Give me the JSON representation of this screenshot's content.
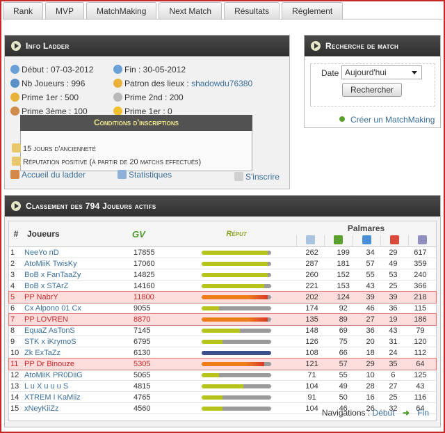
{
  "tabs": [
    "Rank",
    "MVP",
    "MatchMaking",
    "Next Match",
    "Résultats",
    "Réglement"
  ],
  "info": {
    "title": "Info Ladder",
    "debut": "Début : 07-03-2012",
    "fin": "Fin : 30-05-2012",
    "nb": "Nb Joueurs : 996",
    "patron_label": "Patron des lieux :",
    "patron": "shadowdu76380",
    "prime1": "Prime 1er : 500",
    "prime2": "Prime 2nd : 200",
    "prime3": "Prime 3ème : 100",
    "prime1b": "Prime 1er : 0",
    "cond_title": "Conditions d'inscriptions",
    "cond1": "15 jours d'ancienneté",
    "cond2": "Réputation positive (à partir de 20 matchs effectués)",
    "accueil": "Accueil du ladder",
    "stats": "Statistiques",
    "inscrire": "S'inscrire"
  },
  "search": {
    "title": "Recherche de match",
    "date_label": "Date",
    "date_value": "Aujourd'hui",
    "button": "Rechercher",
    "create": "Créer un MatchMaking"
  },
  "ranking": {
    "title": "Classement des 794 Joueurs actifs",
    "col_num": "#",
    "col_player": "Joueurs",
    "col_gv": "GV",
    "col_rep": "Réput",
    "palmares": "Palmares",
    "rows": [
      {
        "n": "1",
        "name": "NeeYo nD",
        "gv": "17855",
        "rep": 0.95,
        "c": [
          "262",
          "199",
          "34",
          "29",
          "617"
        ],
        "hl": false
      },
      {
        "n": "2",
        "name": "AtoMiiK TwisKy",
        "gv": "17060",
        "rep": 0.95,
        "c": [
          "287",
          "181",
          "57",
          "49",
          "359"
        ],
        "hl": false
      },
      {
        "n": "3",
        "name": "BoB x FanTaaZy",
        "gv": "14825",
        "rep": 0.95,
        "c": [
          "260",
          "152",
          "55",
          "53",
          "240"
        ],
        "hl": false
      },
      {
        "n": "4",
        "name": "BoB x STArZ",
        "gv": "14160",
        "rep": 0.9,
        "c": [
          "221",
          "153",
          "43",
          "25",
          "366"
        ],
        "hl": false
      },
      {
        "n": "5",
        "name": "PP NabrY",
        "gv": "11800",
        "rep": 0.95,
        "c": [
          "202",
          "124",
          "39",
          "39",
          "218"
        ],
        "hl": true
      },
      {
        "n": "6",
        "name": "Cx Alpono 01 Cx",
        "gv": "9055",
        "rep": 0.25,
        "c": [
          "174",
          "92",
          "46",
          "36",
          "115"
        ],
        "hl": false
      },
      {
        "n": "7",
        "name": "PP LOVREN",
        "gv": "8870",
        "rep": 0.95,
        "c": [
          "135",
          "89",
          "27",
          "19",
          "186"
        ],
        "hl": true
      },
      {
        "n": "8",
        "name": "EquaZ AsTonS",
        "gv": "7145",
        "rep": 0.55,
        "c": [
          "148",
          "69",
          "36",
          "43",
          "79"
        ],
        "hl": false
      },
      {
        "n": "9",
        "name": "STK x iKrymoS",
        "gv": "6795",
        "rep": 0.3,
        "c": [
          "126",
          "75",
          "20",
          "31",
          "120"
        ],
        "hl": false
      },
      {
        "n": "10",
        "name": "Zk ExTaZz",
        "gv": "6130",
        "rep": 1.0,
        "c": [
          "108",
          "66",
          "18",
          "24",
          "112"
        ],
        "hl": false
      },
      {
        "n": "11",
        "name": "PP Dr Binouze",
        "gv": "5305",
        "rep": 0.9,
        "c": [
          "121",
          "57",
          "29",
          "35",
          "64"
        ],
        "hl": true
      },
      {
        "n": "12",
        "name": "AtoMiiK PR0DiiG",
        "gv": "5065",
        "rep": 0.25,
        "c": [
          "71",
          "55",
          "10",
          "6",
          "125"
        ],
        "hl": false
      },
      {
        "n": "13",
        "name": "L u X u u u S",
        "gv": "4815",
        "rep": 0.6,
        "c": [
          "104",
          "49",
          "28",
          "27",
          "43"
        ],
        "hl": false
      },
      {
        "n": "14",
        "name": "XTREM I KaMiiz",
        "gv": "4765",
        "rep": 0.3,
        "c": [
          "91",
          "50",
          "16",
          "25",
          "116"
        ],
        "hl": false
      },
      {
        "n": "15",
        "name": "xNeyKiiZz",
        "gv": "4560",
        "rep": 0.3,
        "c": [
          "104",
          "46",
          "26",
          "32",
          "64"
        ],
        "hl": false
      }
    ],
    "nav_label": "Navigations :",
    "nav_start": "Début",
    "nav_end": "Fin"
  },
  "colors": {
    "accent": "#c62828",
    "link": "#3a6f9a",
    "bar_yellow": "#b8c41e",
    "bar_orange": "#ef7d1a",
    "bar_blue": "#3b4f8c"
  }
}
